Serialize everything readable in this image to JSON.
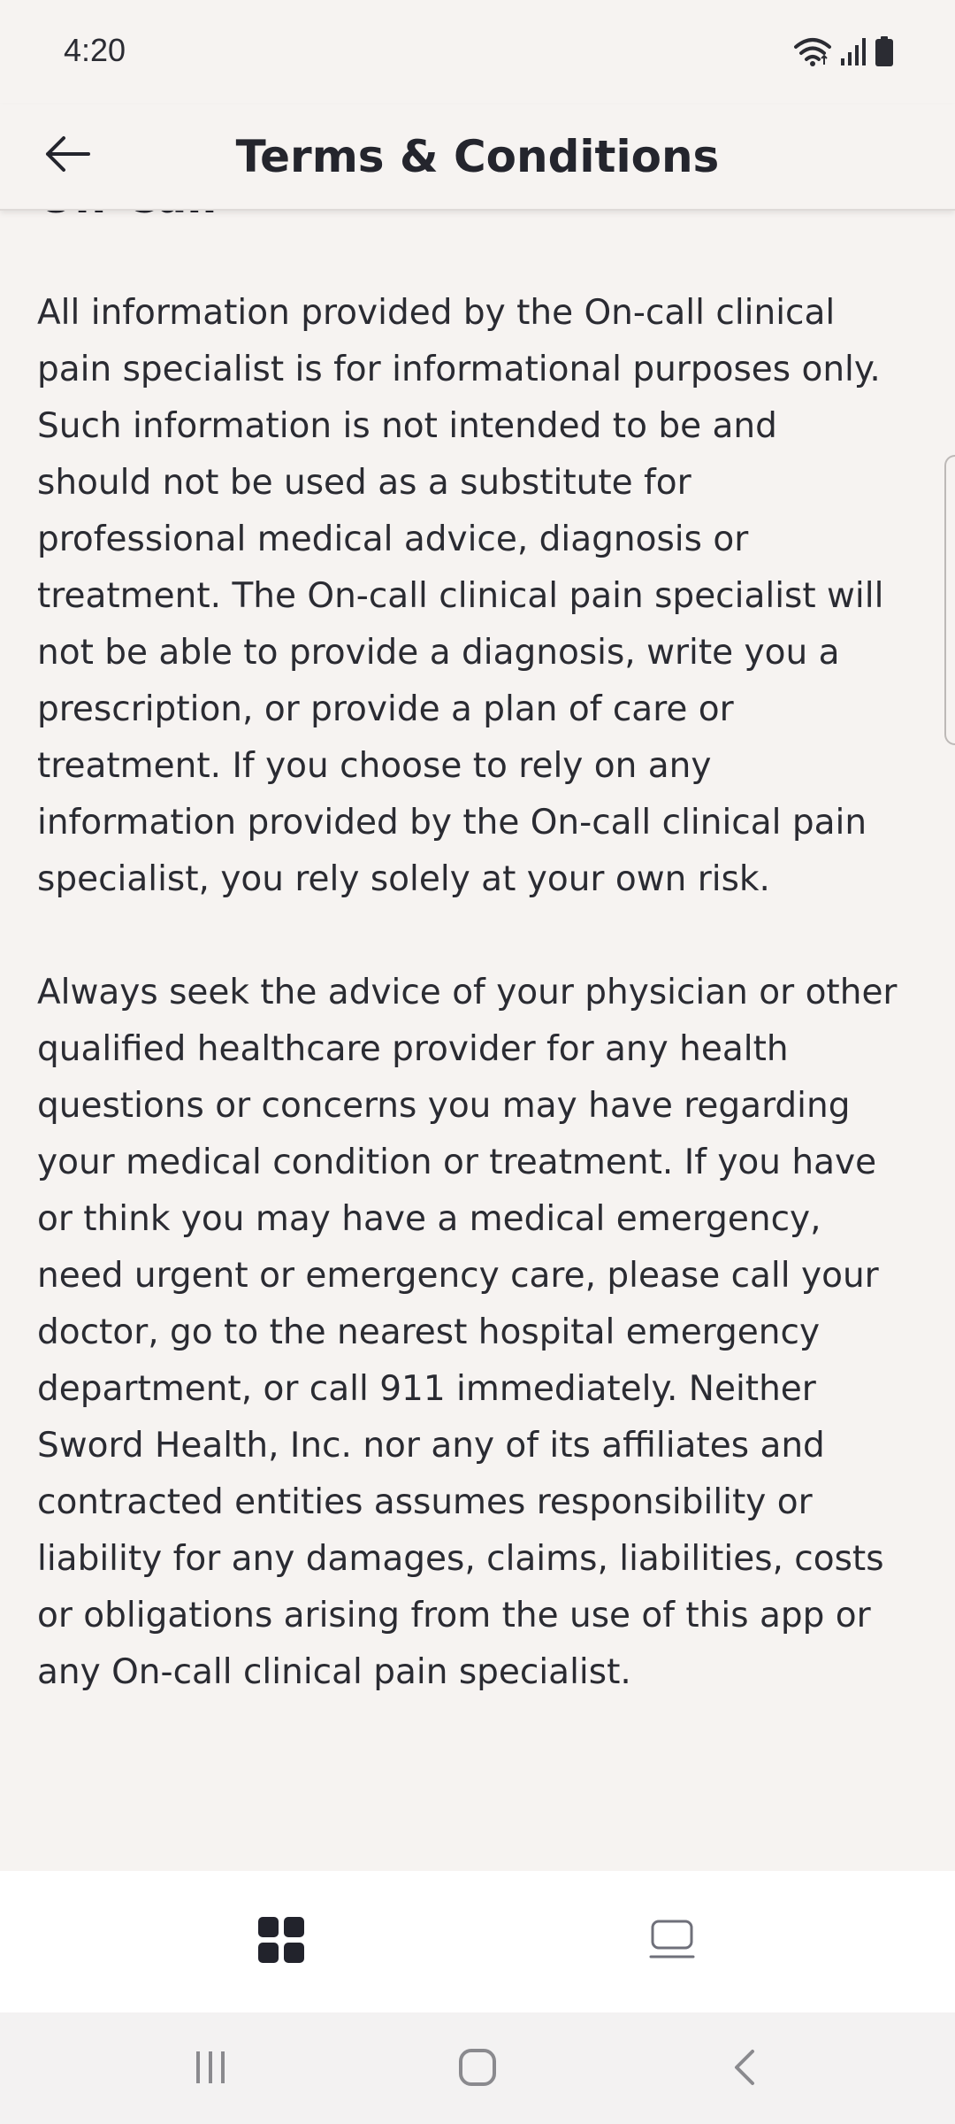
{
  "status_bar": {
    "time": "4:20",
    "icons": [
      "wifi-icon",
      "signal-icon",
      "battery-icon"
    ]
  },
  "header": {
    "back_icon": "arrow-left-icon",
    "title": "Terms & Conditions"
  },
  "content": {
    "section_heading": "On-Call",
    "paragraphs": [
      "All information provided by the On-call clinical\npain specialist is for informational purposes only.\nSuch information is not intended to be and\nshould not be used as a substitute for\nprofessional medical advice, diagnosis or\ntreatment. The On-call clinical pain specialist will\nnot be able to provide a diagnosis, write you a\nprescription, or provide a plan of care or\ntreatment. If you choose to rely on any\ninformation provided by the On-call clinical pain\nspecialist, you rely solely at your own risk.",
      "Always seek the advice of your physician or other\nqualified healthcare provider for any health\nquestions or concerns you may have regarding\nyour medical condition or treatment. If you have\nor think you may have a medical emergency,\nneed urgent or emergency care, please call your\ndoctor, go to the nearest hospital emergency\ndepartment, or call 911 immediately. Neither\nSword Health, Inc. nor any of its affiliates and\ncontracted entities assumes responsibility or\nliability for any damages, claims, liabilities, costs\nor obligations arising from the use of this app or\nany On-call clinical pain specialist."
    ]
  },
  "bottom_nav": {
    "items": [
      {
        "icon": "dashboard-grid-icon",
        "active": true
      },
      {
        "icon": "device-icon",
        "active": false
      }
    ]
  },
  "system_nav": {
    "icons": [
      "recent-apps-icon",
      "home-icon",
      "back-chevron-icon"
    ]
  },
  "colors": {
    "background": "#f6f3f1",
    "text": "#22232c",
    "nav_background": "#ffffff",
    "system_nav_background": "#f3f2f2"
  }
}
